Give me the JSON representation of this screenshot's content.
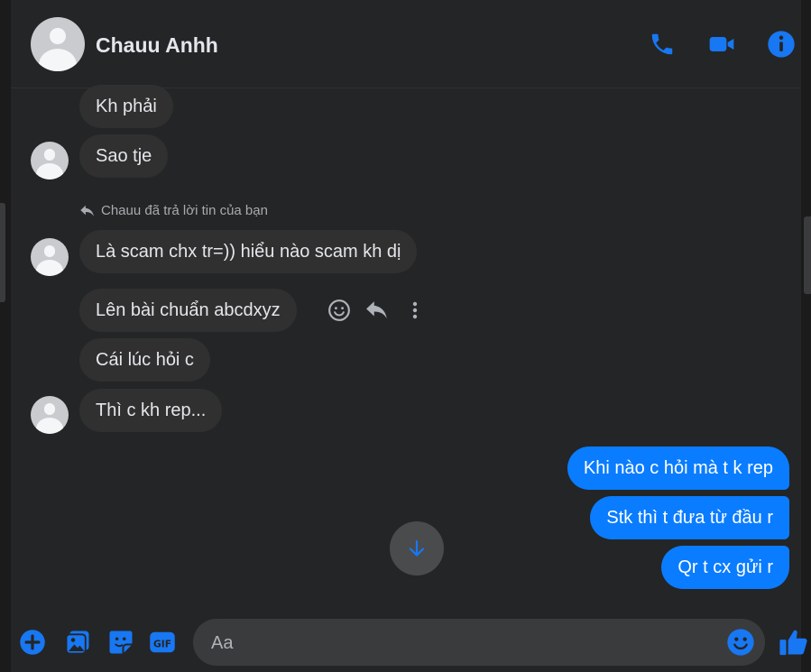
{
  "header": {
    "contact_name": "Chauu Anhh"
  },
  "reply_note": "Chauu đã trả lời tin của bạn",
  "messages": {
    "m1": "Kh phải",
    "m2": "Sao tje",
    "m3": "Là scam chx tr=)) hiểu nào scam kh dị",
    "m4": "Lên bài chuẩn abcdxyz",
    "m5": "Cái lúc hỏi c",
    "m6": "Thì c kh rep...",
    "o1": "Khi nào c hỏi mà t k rep",
    "o2": "Stk thì t đưa từ đầu r",
    "o3": "Qr t cx gửi r"
  },
  "composer": {
    "placeholder": "Aa"
  },
  "colors": {
    "accent": "#0a7cff",
    "icon_blue": "#1877f2",
    "background": "#242526",
    "bubble_in": "#303030"
  }
}
